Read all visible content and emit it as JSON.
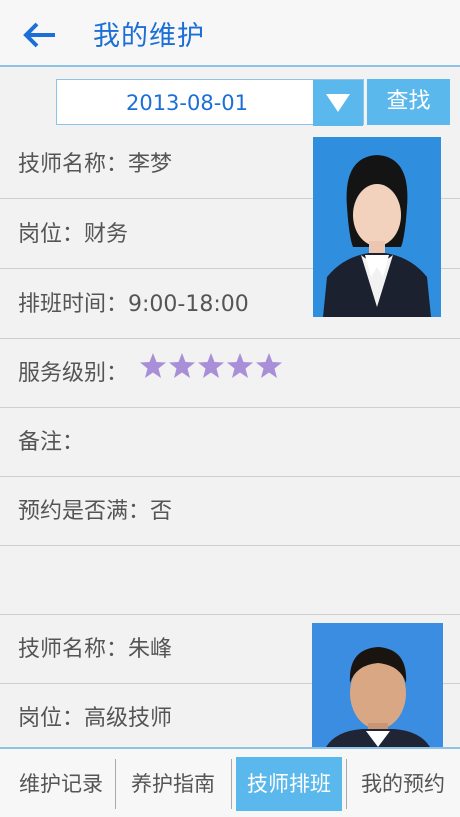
{
  "header": {
    "title": "我的维护"
  },
  "search": {
    "date": "2013-08-01",
    "button_label": "查找"
  },
  "technicians": [
    {
      "name_label": "技师名称：",
      "name": "李梦",
      "position_label": "岗位：",
      "position": "财务",
      "schedule_label": "排班时间：",
      "schedule": "9:00-18:00",
      "level_label": "服务级别：",
      "rating": 5,
      "note_label": "备注：",
      "note": "",
      "full_label": "预约是否满：",
      "full": "否"
    },
    {
      "name_label": "技师名称：",
      "name": "朱峰",
      "position_label": "岗位：",
      "position": "高级技师"
    }
  ],
  "nav": {
    "tabs": [
      {
        "label": "维护记录",
        "active": false
      },
      {
        "label": "养护指南",
        "active": false
      },
      {
        "label": "技师排班",
        "active": true
      },
      {
        "label": "我的预约",
        "active": false
      }
    ]
  },
  "colors": {
    "accent": "#5bb8ec",
    "title": "#1b6fd6",
    "star": "#a98fd8"
  }
}
